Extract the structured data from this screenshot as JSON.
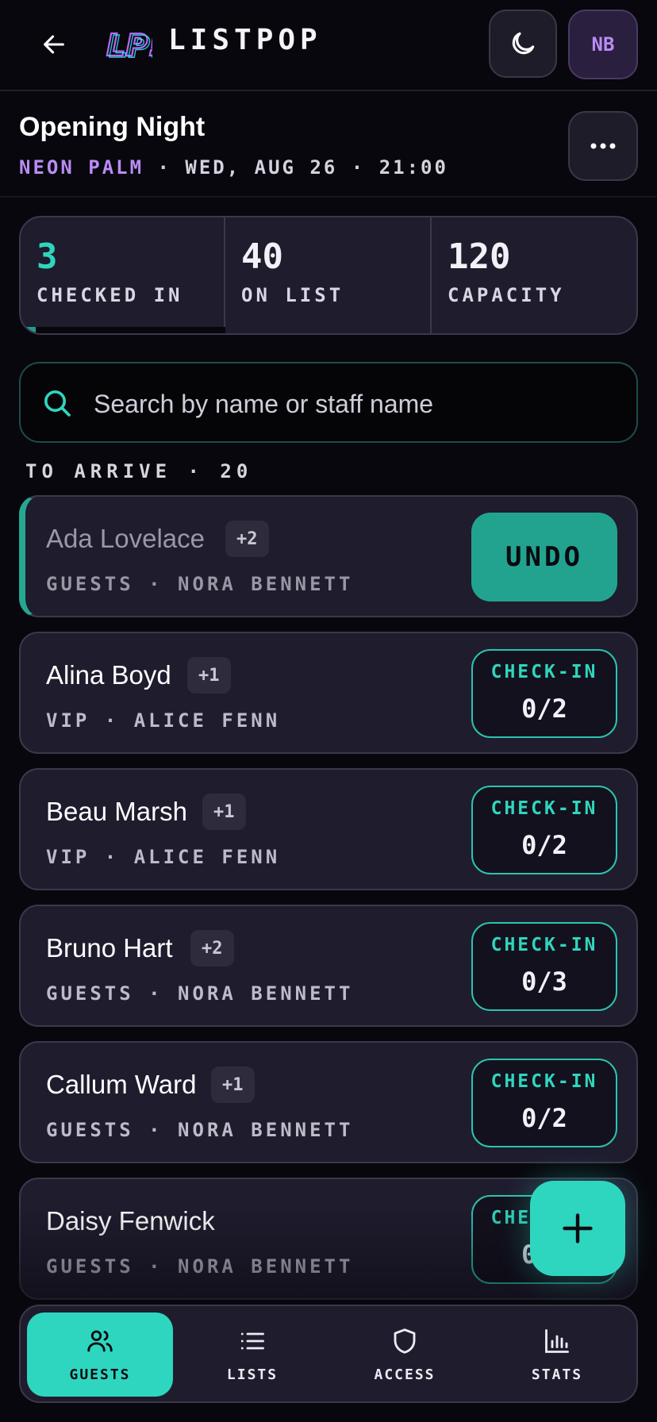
{
  "header": {
    "brand": "LISTPOP",
    "logo_text": "LP!",
    "avatar_initials": "NB"
  },
  "event": {
    "title": "Opening Night",
    "venue": "NEON PALM",
    "datetime": "· WED, AUG 26 · 21:00"
  },
  "stats": {
    "checked_in": {
      "value": "3",
      "label": "CHECKED IN"
    },
    "on_list": {
      "value": "40",
      "label": "ON LIST"
    },
    "capacity": {
      "value": "120",
      "label": "CAPACITY"
    },
    "progress_fraction": 0.075
  },
  "search": {
    "placeholder": "Search by name or staff name",
    "value": ""
  },
  "section": {
    "label": "TO ARRIVE · 20"
  },
  "guests": [
    {
      "name": "Ada Lovelace",
      "plus": "+2",
      "meta": "GUESTS · NORA BENNETT",
      "checked": true,
      "action": "UNDO"
    },
    {
      "name": "Alina Boyd",
      "plus": "+1",
      "meta": "VIP · ALICE FENN",
      "checked": false,
      "action": "CHECK-IN",
      "count": "0/2"
    },
    {
      "name": "Beau Marsh",
      "plus": "+1",
      "meta": "VIP · ALICE FENN",
      "checked": false,
      "action": "CHECK-IN",
      "count": "0/2"
    },
    {
      "name": "Bruno Hart",
      "plus": "+2",
      "meta": "GUESTS · NORA BENNETT",
      "checked": false,
      "action": "CHECK-IN",
      "count": "0/3"
    },
    {
      "name": "Callum Ward",
      "plus": "+1",
      "meta": "GUESTS · NORA BENNETT",
      "checked": false,
      "action": "CHECK-IN",
      "count": "0/2"
    },
    {
      "name": "Daisy Fenwick",
      "plus": "",
      "meta": "GUESTS · NORA BENNETT",
      "checked": false,
      "action": "CHECK-IN",
      "count": "0/1"
    }
  ],
  "nav": [
    {
      "label": "GUESTS",
      "icon": "users-icon",
      "active": true
    },
    {
      "label": "LISTS",
      "icon": "list-icon",
      "active": false
    },
    {
      "label": "ACCESS",
      "icon": "shield-icon",
      "active": false
    },
    {
      "label": "STATS",
      "icon": "bar-chart-icon",
      "active": false
    }
  ],
  "colors": {
    "accent": "#2ed6bf",
    "purple": "#b98cf6",
    "card": "#1f1c2e",
    "background": "#08070d"
  }
}
